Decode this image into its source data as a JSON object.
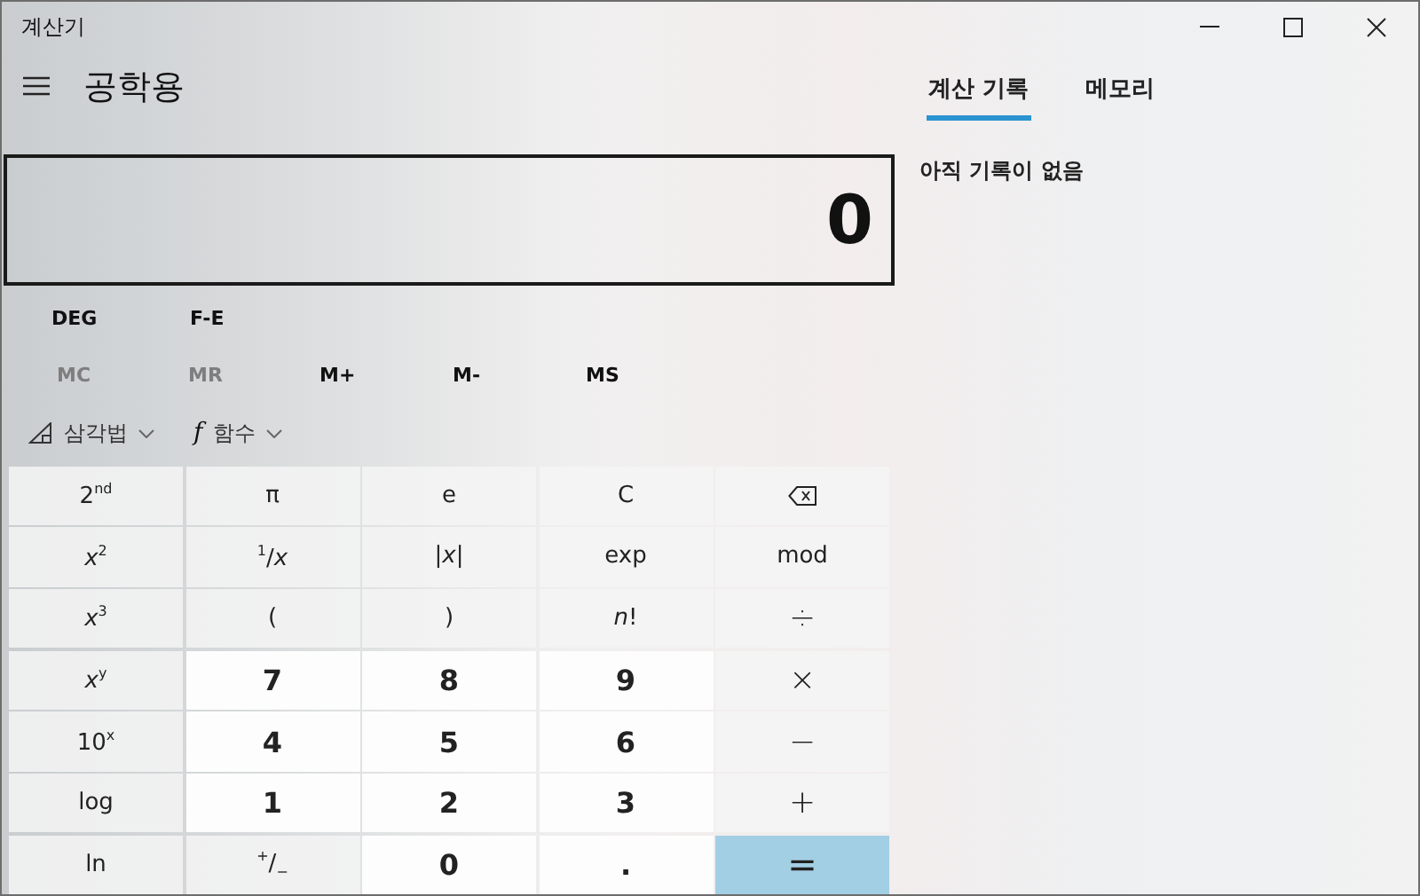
{
  "window": {
    "title": "계산기"
  },
  "header": {
    "mode": "공학용"
  },
  "display": {
    "value": "0"
  },
  "angle_row": [
    {
      "label": "DEG"
    },
    {
      "label": "F-E"
    }
  ],
  "memory_buttons": [
    {
      "label": "MC",
      "disabled": true
    },
    {
      "label": "MR",
      "disabled": true
    },
    {
      "label": "M+",
      "disabled": false
    },
    {
      "label": "M-",
      "disabled": false
    },
    {
      "label": "MS",
      "disabled": false
    }
  ],
  "dropdowns": [
    {
      "kind": "trig",
      "label": "삼각법"
    },
    {
      "kind": "func",
      "icon": "f",
      "label": "함수"
    }
  ],
  "keys": [
    {
      "kind": "fn",
      "label": "2$^{nd}$"
    },
    {
      "kind": "fn",
      "label": "π"
    },
    {
      "kind": "fn",
      "label": "e"
    },
    {
      "kind": "fn",
      "label": "C"
    },
    {
      "kind": "backspace"
    },
    {
      "kind": "fn",
      "label": "*x*$^{2}$"
    },
    {
      "kind": "fn",
      "label": "$^{1}$/*x*"
    },
    {
      "kind": "fn",
      "label": "|*x*|"
    },
    {
      "kind": "fn",
      "label": "exp"
    },
    {
      "kind": "fn",
      "label": "mod"
    },
    {
      "kind": "fn",
      "label": "*x*$^{3}$"
    },
    {
      "kind": "fn",
      "label": "("
    },
    {
      "kind": "fn",
      "label": ")"
    },
    {
      "kind": "fn",
      "label": "*n*!"
    },
    {
      "kind": "op",
      "label": "÷"
    },
    {
      "kind": "fn",
      "label": "*x*$^{y}$"
    },
    {
      "kind": "digit",
      "label": "7"
    },
    {
      "kind": "digit",
      "label": "8"
    },
    {
      "kind": "digit",
      "label": "9"
    },
    {
      "kind": "op",
      "label": "×"
    },
    {
      "kind": "fn",
      "label": "10$^{x}$"
    },
    {
      "kind": "digit",
      "label": "4"
    },
    {
      "kind": "digit",
      "label": "5"
    },
    {
      "kind": "digit",
      "label": "6"
    },
    {
      "kind": "op",
      "label": "−"
    },
    {
      "kind": "fn",
      "label": "log"
    },
    {
      "kind": "digit",
      "label": "1"
    },
    {
      "kind": "digit",
      "label": "2"
    },
    {
      "kind": "digit",
      "label": "3"
    },
    {
      "kind": "op",
      "label": "+"
    },
    {
      "kind": "fn",
      "label": "ln"
    },
    {
      "kind": "fn",
      "label": "$^{+}$/$_{−}$"
    },
    {
      "kind": "digit",
      "label": "0"
    },
    {
      "kind": "digit",
      "label": "."
    },
    {
      "kind": "equals",
      "label": "="
    }
  ],
  "side_tabs": [
    {
      "label": "계산 기록",
      "selected": true
    },
    {
      "label": "메모리",
      "selected": false
    }
  ],
  "history": {
    "empty_message": "아직 기록이 없음"
  }
}
